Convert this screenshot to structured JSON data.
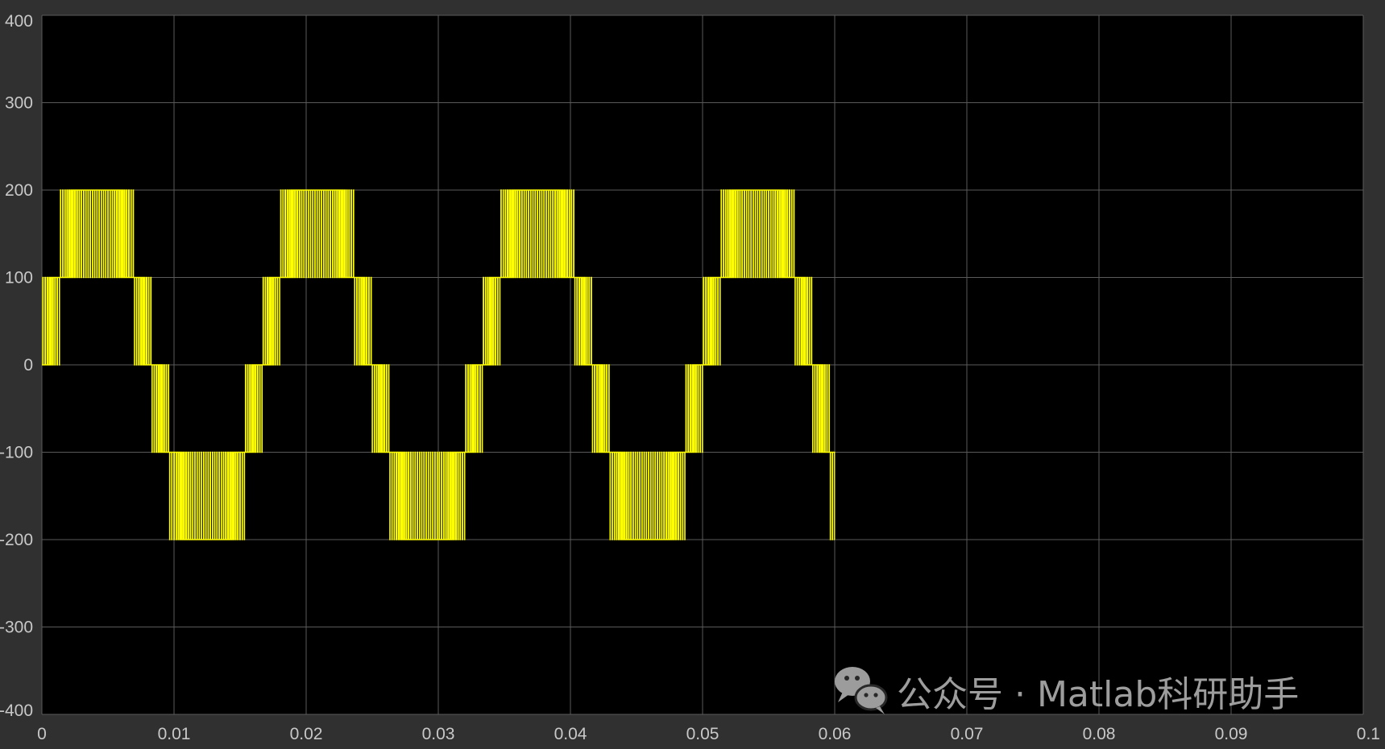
{
  "chart_data": {
    "type": "line",
    "title": "",
    "xlabel": "",
    "ylabel": "",
    "xlim": [
      0,
      0.1
    ],
    "ylim": [
      -400,
      400
    ],
    "grid": true,
    "x_ticks": [
      "0",
      "0.01",
      "0.02",
      "0.03",
      "0.04",
      "0.05",
      "0.06",
      "0.07",
      "0.08",
      "0.09",
      "0.1"
    ],
    "x_tick_values": [
      0,
      0.01,
      0.02,
      0.03,
      0.04,
      0.05,
      0.06,
      0.07,
      0.08,
      0.09,
      0.1
    ],
    "y_ticks": [
      "400",
      "300",
      "200",
      "100",
      "0",
      "-100",
      "-200",
      "-300",
      "-400"
    ],
    "y_tick_values": [
      400,
      300,
      200,
      100,
      0,
      -100,
      -200,
      -300,
      -400
    ],
    "series": [
      {
        "color": "#ffff00",
        "description_levels": [
          -200,
          -100,
          0,
          100,
          200
        ],
        "fundamental_frequency_hz": 60,
        "peak": 200,
        "end_time": 0.06
      }
    ],
    "background": "#000000",
    "frame_background": "#303030",
    "grid_color": "#5a5a5a",
    "tick_label_color": "#c8c8c8"
  },
  "watermark": {
    "icon": "wechat-icon",
    "text": "公众号 · Matlab科研助手"
  }
}
